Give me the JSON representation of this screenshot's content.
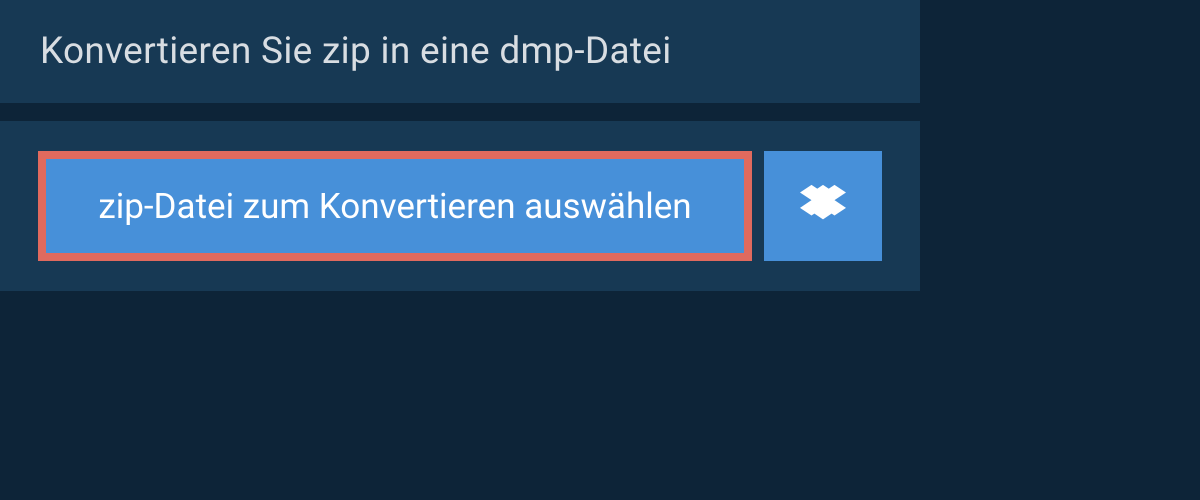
{
  "header": {
    "title": "Konvertieren Sie zip in eine dmp-Datei"
  },
  "actions": {
    "select_file_label": "zip-Datei zum Konvertieren auswählen"
  },
  "colors": {
    "background": "#0d2438",
    "panel": "#173954",
    "button": "#4790d9",
    "highlight_border": "#e06a5e",
    "text": "#d8dde2"
  }
}
